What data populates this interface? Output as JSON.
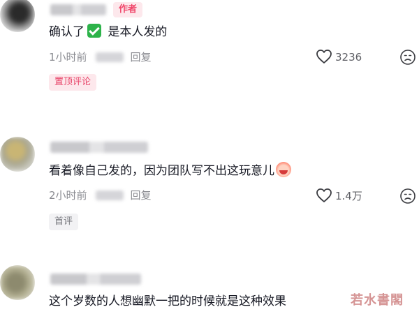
{
  "comments": [
    {
      "author_tag": "作者",
      "text_before": "确认了",
      "text_after": " 是本人发的",
      "time": "1小时前",
      "reply": "回复",
      "likes": "3236",
      "badge": "置顶评论"
    },
    {
      "text": "看着像自己发的，因为团队写不出这玩意儿",
      "time": "2小时前",
      "reply": "回复",
      "likes": "1.4万",
      "badge": "首评"
    },
    {
      "text": "这个岁数的人想幽默一把的时候就是这种效果"
    }
  ],
  "watermark": "若水書閣",
  "icons": {
    "check": "check-mark-icon",
    "emoji": "crying-laughing-emoji-icon",
    "heart": "heart-outline-icon",
    "dislike": "frown-face-icon"
  },
  "colors": {
    "author_tag_bg": "#fde8ec",
    "author_tag_text": "#f0466a",
    "meta_text": "#8a8b91",
    "check_green": "#2db34a"
  }
}
